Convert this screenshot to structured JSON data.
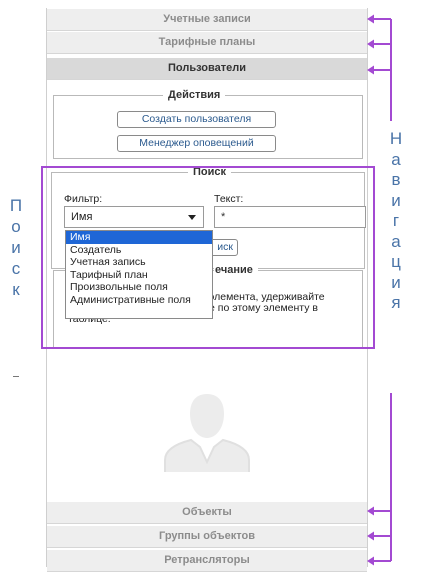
{
  "accordion_top": [
    "Учетные записи",
    "Тарифные планы",
    "Пользователи"
  ],
  "accordion_bottom": [
    "Объекты",
    "Группы объектов",
    "Ретрансляторы"
  ],
  "actions": {
    "legend": "Действия",
    "create_user": "Создать пользователя",
    "notification_manager": "Менеджер оповещений"
  },
  "search": {
    "legend": "Поиск",
    "filter_label": "Фильтр:",
    "text_label": "Текст:",
    "selected_filter": "Имя",
    "text_value": "*",
    "search_button_partial": "иск",
    "filter_options": [
      "Имя",
      "Создатель",
      "Учетная запись",
      "Тарифный план",
      "Произвольные поля",
      "Административные поля"
    ]
  },
  "note": {
    "legend_partial": "ечание",
    "line1_tail": "элемента, удерживайте",
    "line2_tail": "е по этому элементу в",
    "line3": "таблице."
  },
  "annotations": {
    "left_vertical": [
      "П",
      "о",
      "и",
      "с",
      "к"
    ],
    "right_vertical": [
      "Н",
      "а",
      "в",
      "и",
      "г",
      "а",
      "ц",
      "и",
      "я"
    ]
  },
  "colors": {
    "annotation_purple": "#a34ad2",
    "annotation_text": "#4a74a8",
    "header_active_bg": "#d9d9d9",
    "header_bg": "#eeeeee",
    "dropdown_selected": "#1e66d6"
  },
  "icons": [
    "user-silhouette-icon",
    "arrow-left-icon"
  ]
}
